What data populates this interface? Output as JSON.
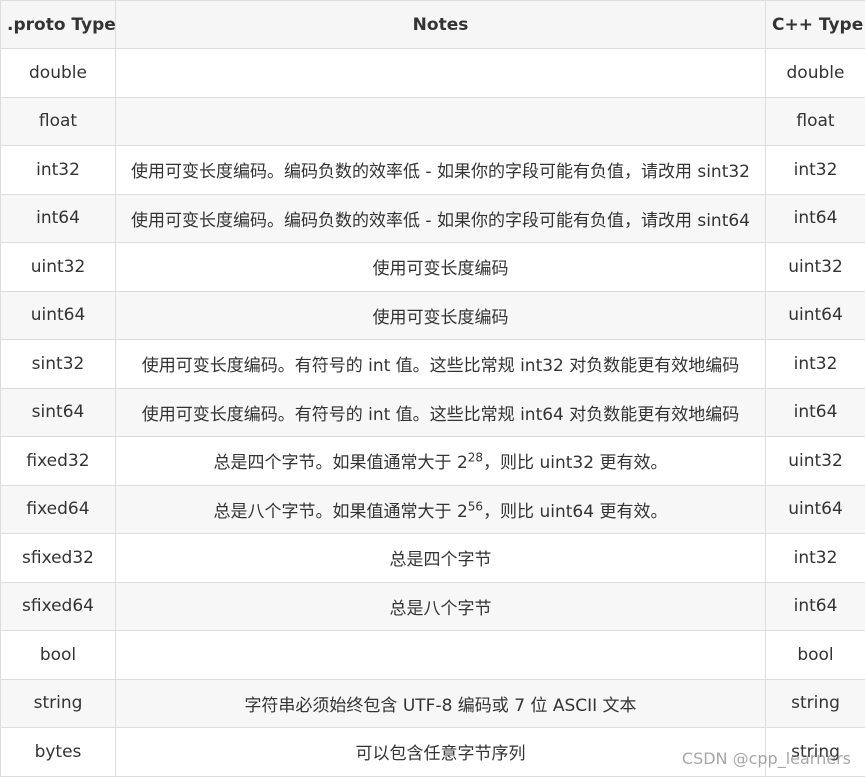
{
  "table": {
    "headers": {
      "proto": ".proto Type",
      "notes": "Notes",
      "cpp": "C++ Type"
    },
    "rows": [
      {
        "proto": "double",
        "notes": "",
        "cpp": "double"
      },
      {
        "proto": "float",
        "notes": "",
        "cpp": "float"
      },
      {
        "proto": "int32",
        "notes": "使用可变长度编码。编码负数的效率低 - 如果你的字段可能有负值，请改用 sint32",
        "cpp": "int32"
      },
      {
        "proto": "int64",
        "notes": "使用可变长度编码。编码负数的效率低 - 如果你的字段可能有负值，请改用 sint64",
        "cpp": "int64"
      },
      {
        "proto": "uint32",
        "notes": "使用可变长度编码",
        "cpp": "uint32"
      },
      {
        "proto": "uint64",
        "notes": "使用可变长度编码",
        "cpp": "uint64"
      },
      {
        "proto": "sint32",
        "notes": "使用可变长度编码。有符号的 int 值。这些比常规 int32 对负数能更有效地编码",
        "cpp": "int32"
      },
      {
        "proto": "sint64",
        "notes": "使用可变长度编码。有符号的 int 值。这些比常规 int64 对负数能更有效地编码",
        "cpp": "int64"
      },
      {
        "proto": "fixed32",
        "notes_pre": "总是四个字节。如果值通常大于 2",
        "notes_sup": "28",
        "notes_post": "，则比 uint32 更有效。",
        "cpp": "uint32"
      },
      {
        "proto": "fixed64",
        "notes_pre": "总是八个字节。如果值通常大于 2",
        "notes_sup": "56",
        "notes_post": "，则比 uint64 更有效。",
        "cpp": "uint64"
      },
      {
        "proto": "sfixed32",
        "notes": "总是四个字节",
        "cpp": "int32"
      },
      {
        "proto": "sfixed64",
        "notes": "总是八个字节",
        "cpp": "int64"
      },
      {
        "proto": "bool",
        "notes": "",
        "cpp": "bool"
      },
      {
        "proto": "string",
        "notes": "字符串必须始终包含 UTF-8 编码或 7 位 ASCII 文本",
        "cpp": "string"
      },
      {
        "proto": "bytes",
        "notes": "可以包含任意字节序列",
        "cpp": "string"
      }
    ]
  },
  "watermark": "CSDN @cpp_learners",
  "colors": {
    "border": "#dddddd",
    "header_bg": "#f6f6f6",
    "stripe_bg": "#f7f7f7",
    "text": "#333333"
  }
}
